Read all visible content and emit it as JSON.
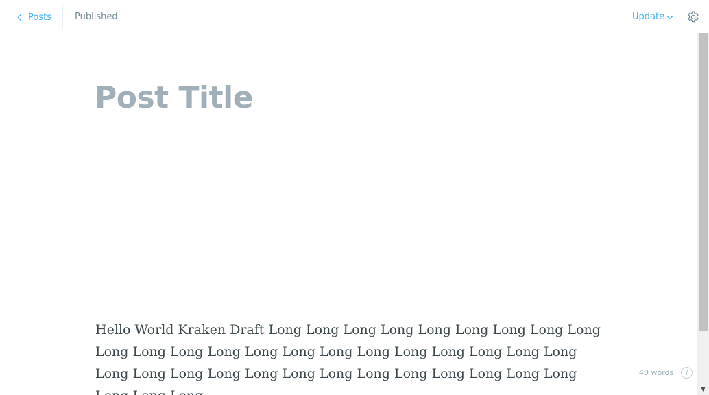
{
  "header": {
    "back_label": "Posts",
    "status": "Published",
    "update_label": "Update"
  },
  "editor": {
    "title_placeholder": "Post Title",
    "body": "Hello World Kraken Draft Long Long Long Long Long Long Long Long Long Long Long Long Long Long Long Long Long Long Long Long Long Long Long Long Long Long Long Long Long Long Long Long Long Long Long Long Long Long"
  },
  "footer": {
    "word_count": "40 words",
    "help_glyph": "?"
  },
  "colors": {
    "accent": "#3eb0ef",
    "title_placeholder": "#a1b0b8",
    "body_text": "#3c484e",
    "muted": "#738a94"
  },
  "icons": {
    "back": "chevron-left-icon",
    "update_caret": "chevron-down-icon",
    "settings": "gear-icon",
    "help": "question-circle-icon"
  }
}
